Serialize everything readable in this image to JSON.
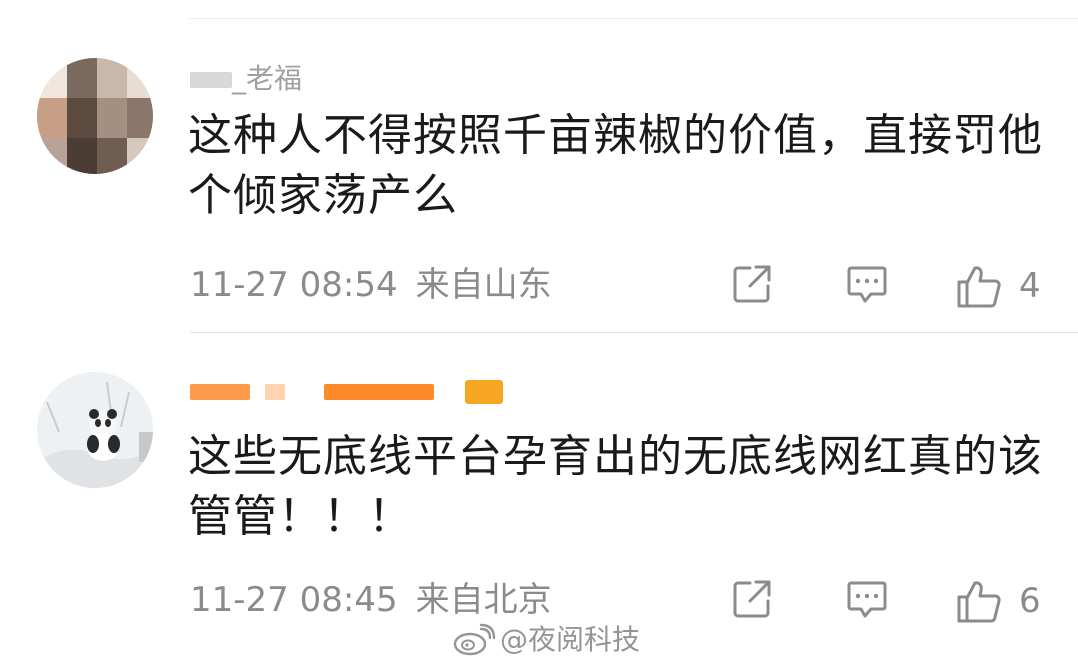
{
  "comments": [
    {
      "username": "_老福",
      "text": "这种人不得按照千亩辣椒的价值，直接罚他个倾家荡产么",
      "time": "11-27 08:54",
      "location": "来自山东",
      "likes": "4",
      "icons": {
        "share": "share-edit-icon",
        "reply": "comment-icon",
        "like": "thumbs-up-icon"
      }
    },
    {
      "username": "",
      "text": "这些无底线平台孕育出的无底线网红真的该管管！！！",
      "time": "11-27 08:45",
      "location": "来自北京",
      "likes": "6",
      "icons": {
        "share": "share-edit-icon",
        "reply": "comment-icon",
        "like": "thumbs-up-icon"
      }
    }
  ],
  "watermark": {
    "text": "@夜阅科技",
    "icon": "weibo-logo-icon"
  },
  "colors": {
    "text": "#1a1a1a",
    "meta": "#8b8b8b",
    "vip_badge": "#f5a623",
    "username_orange": "#ff8a2b"
  }
}
